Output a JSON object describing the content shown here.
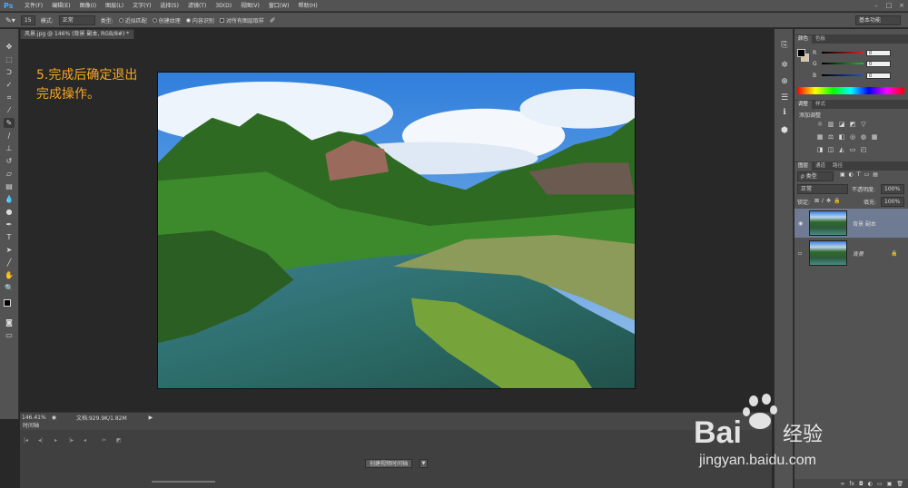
{
  "app": {
    "logo": "Ps"
  },
  "menu": [
    "文件(F)",
    "编辑(E)",
    "图像(I)",
    "图层(L)",
    "文字(Y)",
    "选择(S)",
    "滤镜(T)",
    "3D(D)",
    "视图(V)",
    "窗口(W)",
    "帮助(H)"
  ],
  "window_controls": [
    "–",
    "□",
    "×"
  ],
  "options": {
    "brush_size": "15",
    "mode_label": "模式:",
    "mode_value": "正常",
    "type_label": "类型:",
    "radio_1": "近似匹配",
    "radio_2": "创建纹理",
    "radio_3": "内容识别",
    "checkbox": "对所有图层取样",
    "workspace": "基本功能"
  },
  "document": {
    "tab_title": "风景.jpg @ 146% (背景 副本, RGB/8#) *",
    "tab_close": "×",
    "annotation_line1": "5.完成后确定退出",
    "annotation_line2": "完成操作。",
    "zoom": "146.41%",
    "doc_info": "文档:929.9K/1.82M",
    "status_arrow": "▶"
  },
  "timeline": {
    "tab": "时间轴",
    "create_button": "创建视频时间轴",
    "dropdown_arrow": "▼"
  },
  "color_panel": {
    "tabs": [
      "颜色",
      "色板"
    ],
    "channels": [
      {
        "label": "R",
        "value": "0",
        "color": "#e02020"
      },
      {
        "label": "G",
        "value": "0",
        "color": "#20c020"
      },
      {
        "label": "B",
        "value": "0",
        "color": "#2050e0"
      }
    ]
  },
  "adjust_panel": {
    "tabs": [
      "调整",
      "样式"
    ],
    "heading": "添加调整"
  },
  "layers_panel": {
    "tabs": [
      "图层",
      "通道",
      "路径"
    ],
    "kind_label": "ρ 类型",
    "blend_mode": "正常",
    "opacity_label": "不透明度:",
    "opacity_value": "100%",
    "lock_label": "锁定:",
    "fill_label": "填充:",
    "fill_value": "100%",
    "layers": [
      {
        "name": "背景 副本",
        "visible": true,
        "selected": true
      },
      {
        "name": "背景",
        "visible": false,
        "selected": false,
        "locked": true
      }
    ]
  },
  "watermark": {
    "brand": "Bai",
    "brand2": "经验",
    "url": "jingyan.baidu.com"
  }
}
